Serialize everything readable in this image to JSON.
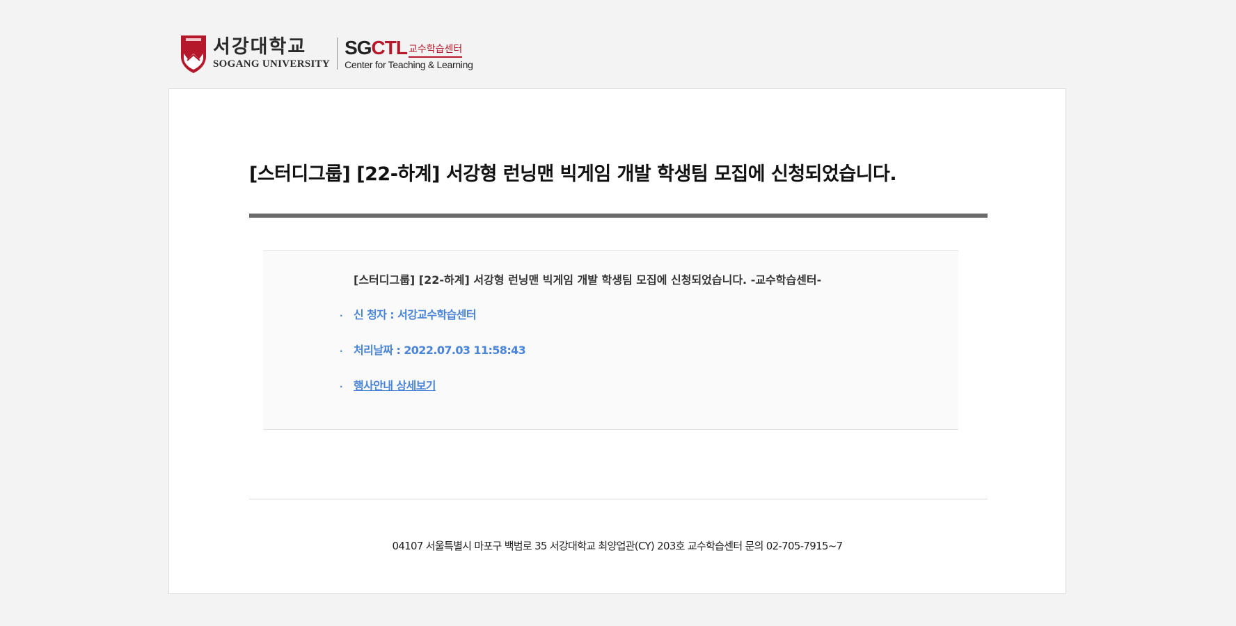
{
  "header": {
    "university_name_ko": "서강대학교",
    "university_name_en": "SOGANG UNIVERSITY",
    "ctl_prefix": "SG",
    "ctl_suffix": "CTL",
    "ctl_name_ko": "교수학습센터",
    "ctl_name_en": "Center for Teaching & Learning",
    "shield_icon": "sogang-shield-icon",
    "brand_color": "#b4182a"
  },
  "main": {
    "title": "[스터디그룹] [22-하계] 서강형 런닝맨 빅게임 개발 학생팀 모집에 신청되었습니다.",
    "info": {
      "heading": "[스터디그룹] [22-하계] 서강형 런닝맨 빅게임 개발 학생팀 모집에 신청되었습니다. -교수학습센터-",
      "applicant": "신 청자 : 서강교수학습센터",
      "processed_date": "처리날짜 : 2022.07.03 11:58:43",
      "detail_link": "행사안내 상세보기",
      "bullet": "."
    },
    "accent_color": "#4a84d6"
  },
  "footer": {
    "address": "04107 서울특별시 마포구 백범로 35 서강대학교 최양업관(CY) 203호 교수학습센터 문의 02-705-7915~7"
  }
}
